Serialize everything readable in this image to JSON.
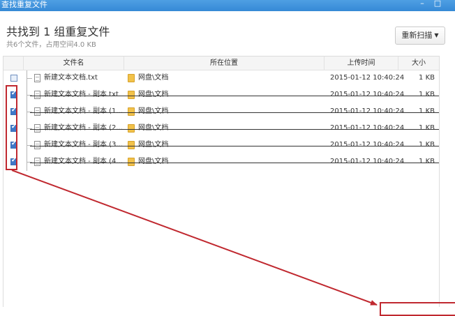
{
  "window": {
    "title": "查找重复文件",
    "minimize_icon": "minimize-icon",
    "close_icon": "close-icon"
  },
  "summary": {
    "heading": "共找到 1 组重复文件",
    "subheading": "共6个文件，占用空间4.0 KB"
  },
  "toolbar": {
    "rescan_label": "重新扫描",
    "rescan_icon": "chevron-down-icon"
  },
  "table": {
    "headers": {
      "name": "文件名",
      "location": "所在位置",
      "modified": "上传时间",
      "size": "大小"
    },
    "rows": [
      {
        "checked": false,
        "name": "新建文本文档.txt",
        "location": "网盘\\文档",
        "modified": "2015-01-12 10:40:24",
        "size": "1 KB",
        "struck": false
      },
      {
        "checked": true,
        "name": "新建文本文档 - 副本.txt",
        "location": "网盘\\文档",
        "modified": "2015-01-12 10:40:24",
        "size": "1 KB",
        "struck": true
      },
      {
        "checked": true,
        "name": "新建文本文档 - 副本 (1...",
        "location": "网盘\\文档",
        "modified": "2015-01-12 10:40:24",
        "size": "1 KB",
        "struck": true
      },
      {
        "checked": true,
        "name": "新建文本文档 - 副本 (2...",
        "location": "网盘\\文档",
        "modified": "2015-01-12 10:40:24",
        "size": "1 KB",
        "struck": true
      },
      {
        "checked": true,
        "name": "新建文本文档 - 副本 (3...",
        "location": "网盘\\文档",
        "modified": "2015-01-12 10:40:24",
        "size": "1 KB",
        "struck": true
      },
      {
        "checked": true,
        "name": "新建文本文档 - 副本 (4...",
        "location": "网盘\\文档",
        "modified": "2015-01-12 10:40:24",
        "size": "1 KB",
        "struck": true
      }
    ]
  },
  "annotation": {
    "color": "#c0282f"
  },
  "colors": {
    "titlebar": "#3b8fdc",
    "checkbox_on": "#3f78c8",
    "folder": "#f2c24a"
  }
}
